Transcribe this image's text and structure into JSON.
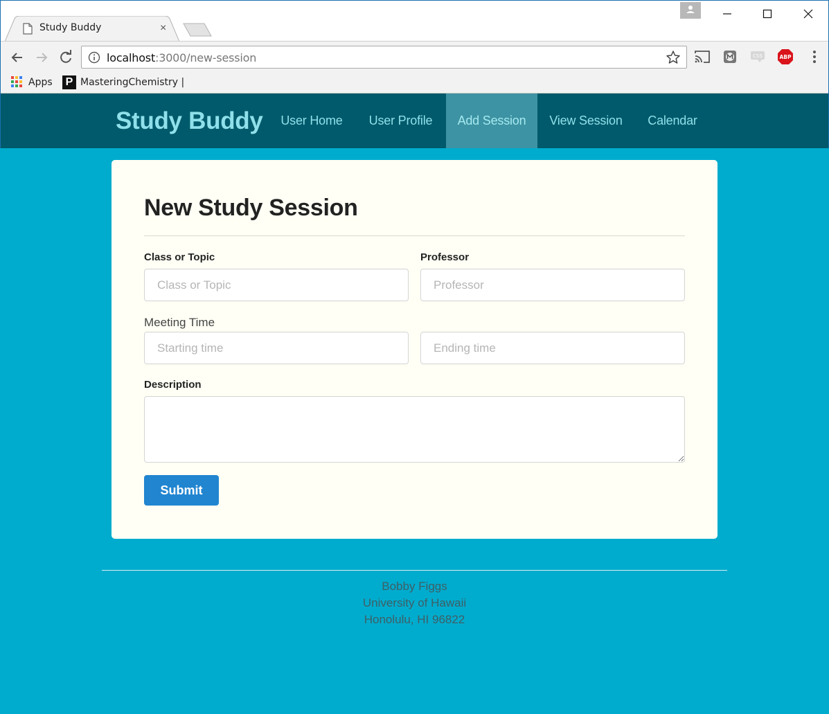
{
  "browser": {
    "tab_title": "Study Buddy",
    "tab_close": "×",
    "url_host": "localhost",
    "url_rest": ":3000/new-session",
    "bookmarks": [
      {
        "label": "Apps"
      },
      {
        "label": "MasteringChemistry |"
      }
    ],
    "bookmark_p_letter": "P",
    "extensions": {
      "css_label": "CSS",
      "abp_label": "ABP"
    }
  },
  "nav": {
    "brand": "Study Buddy",
    "items": [
      {
        "label": "User Home"
      },
      {
        "label": "User Profile"
      },
      {
        "label": "Add Session"
      },
      {
        "label": "View Session"
      },
      {
        "label": "Calendar"
      }
    ],
    "active_item": "Add Session"
  },
  "form": {
    "title": "New Study Session",
    "class_label": "Class or Topic",
    "class_placeholder": "Class or Topic",
    "professor_label": "Professor",
    "professor_placeholder": "Professor",
    "meeting_label": "Meeting Time",
    "start_placeholder": "Starting time",
    "end_placeholder": "Ending time",
    "description_label": "Description",
    "submit_label": "Submit"
  },
  "footer": {
    "line1": "Bobby Figgs",
    "line2": "University of Hawaii",
    "line3": "Honolulu, HI 96822"
  },
  "colors": {
    "page_bg": "#00acce",
    "nav_bg": "#005a6b",
    "nav_text": "#8fe0ea",
    "nav_active_bg": "#3d93a3",
    "card_bg": "#fffff5",
    "submit_bg": "#2185d0"
  }
}
